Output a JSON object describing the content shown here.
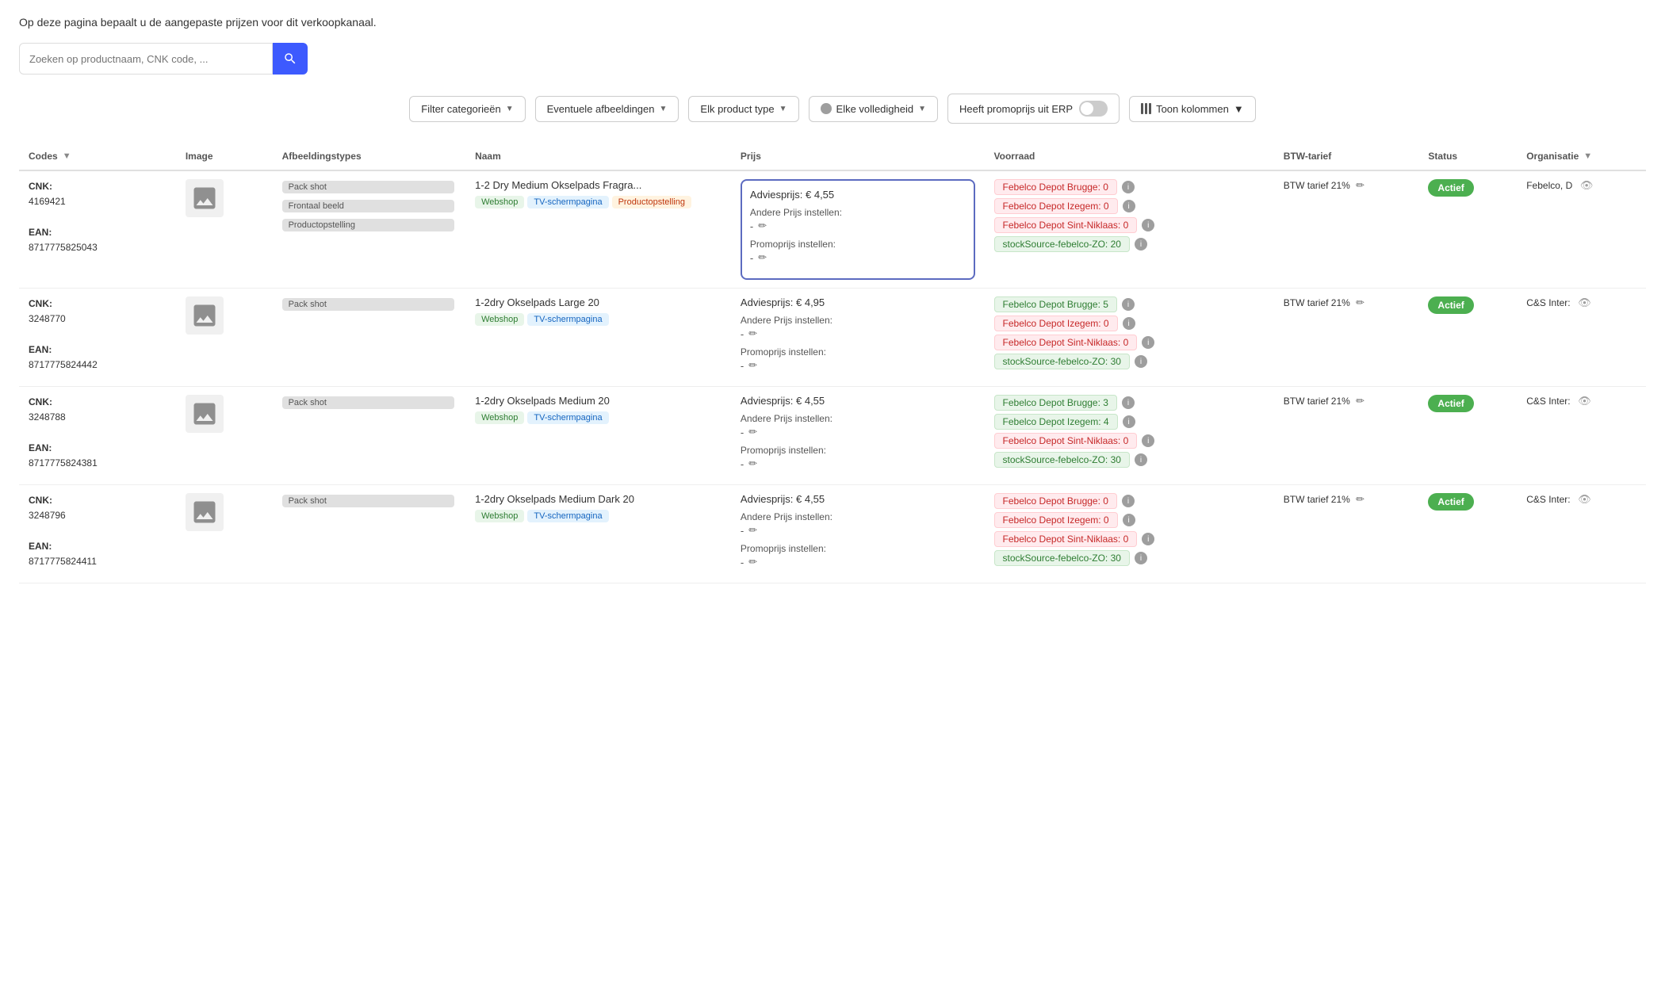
{
  "page": {
    "description": "Op deze pagina bepaalt u de aangepaste prijzen voor dit verkoopkanaal.",
    "search": {
      "placeholder": "Zoeken op productnaam, CNK code, ..."
    },
    "filters": {
      "categories_label": "Filter categorieën",
      "images_label": "Eventuele afbeeldingen",
      "product_type_label": "Elk product type",
      "completeness_label": "Elke volledigheid",
      "promo_label": "Heeft promoprijs uit ERP",
      "columns_label": "Toon kolommen"
    },
    "table": {
      "headers": [
        "Codes",
        "Image",
        "Afbeeldingstypes",
        "Naam",
        "Prijs",
        "Voorraad",
        "BTW-tarief",
        "Status",
        "Organisatie"
      ],
      "rows": [
        {
          "cnk": "CNK:",
          "cnk_value": "4169421",
          "ean": "EAN:",
          "ean_value": "8717775825043",
          "image_alt": "product image",
          "image_types": [
            "Pack shot",
            "Frontaal beeld"
          ],
          "image_type_extra": [
            "Productopstelling"
          ],
          "tags": [
            "Webshop",
            "TV-schermpagina",
            "Productopstelling"
          ],
          "naam": "1-2 Dry Medium Okselpads Fragra...",
          "adviesprijs": "Adviesprijs: € 4,55",
          "andere_prijs_label": "Andere Prijs instellen:",
          "andere_prijs_value": "-",
          "promo_label": "Promoprijs instellen:",
          "promo_value": "-",
          "highlighted": true,
          "stock": [
            {
              "label": "Febelco Depot Brugge: 0",
              "type": "red"
            },
            {
              "label": "Febelco Depot Izegem: 0",
              "type": "red"
            },
            {
              "label": "Febelco Depot Sint-Niklaas: 0",
              "type": "red"
            },
            {
              "label": "stockSource-febelco-ZO: 20",
              "type": "green"
            }
          ],
          "btw": "BTW tarief 21%",
          "status": "Actief",
          "org": "Febelco, D"
        },
        {
          "cnk": "CNK:",
          "cnk_value": "3248770",
          "ean": "EAN:",
          "ean_value": "8717775824442",
          "image_alt": "product image",
          "image_types": [
            "Pack shot"
          ],
          "tags": [
            "Webshop",
            "TV-schermpagina"
          ],
          "naam": "1-2dry Okselpads Large 20",
          "adviesprijs": "Adviesprijs: € 4,95",
          "andere_prijs_label": "Andere Prijs instellen:",
          "andere_prijs_value": "-",
          "promo_label": "Promoprijs instellen:",
          "promo_value": "-",
          "highlighted": false,
          "stock": [
            {
              "label": "Febelco Depot Brugge: 5",
              "type": "green"
            },
            {
              "label": "Febelco Depot Izegem: 0",
              "type": "red"
            },
            {
              "label": "Febelco Depot Sint-Niklaas: 0",
              "type": "red"
            },
            {
              "label": "stockSource-febelco-ZO: 30",
              "type": "green"
            }
          ],
          "btw": "BTW tarief 21%",
          "status": "Actief",
          "org": "C&S Inter:"
        },
        {
          "cnk": "CNK:",
          "cnk_value": "3248788",
          "ean": "EAN:",
          "ean_value": "8717775824381",
          "image_alt": "product image",
          "image_types": [
            "Pack shot"
          ],
          "tags": [
            "Webshop",
            "TV-schermpagina"
          ],
          "naam": "1-2dry Okselpads Medium 20",
          "adviesprijs": "Adviesprijs: € 4,55",
          "andere_prijs_label": "Andere Prijs instellen:",
          "andere_prijs_value": "-",
          "promo_label": "Promoprijs instellen:",
          "promo_value": "-",
          "highlighted": false,
          "stock": [
            {
              "label": "Febelco Depot Brugge: 3",
              "type": "green"
            },
            {
              "label": "Febelco Depot Izegem: 4",
              "type": "green"
            },
            {
              "label": "Febelco Depot Sint-Niklaas: 0",
              "type": "red"
            },
            {
              "label": "stockSource-febelco-ZO: 30",
              "type": "green"
            }
          ],
          "btw": "BTW tarief 21%",
          "status": "Actief",
          "org": "C&S Inter:"
        },
        {
          "cnk": "CNK:",
          "cnk_value": "3248796",
          "ean": "EAN:",
          "ean_value": "8717775824411",
          "image_alt": "product image",
          "image_types": [
            "Pack shot"
          ],
          "tags": [
            "Webshop",
            "TV-schermpagina"
          ],
          "naam": "1-2dry Okselpads Medium Dark 20",
          "adviesprijs": "Adviesprijs: € 4,55",
          "andere_prijs_label": "Andere Prijs instellen:",
          "andere_prijs_value": "-",
          "promo_label": "Promoprijs instellen:",
          "promo_value": "-",
          "highlighted": false,
          "stock": [
            {
              "label": "Febelco Depot Brugge: 0",
              "type": "red"
            },
            {
              "label": "Febelco Depot Izegem: 0",
              "type": "red"
            },
            {
              "label": "Febelco Depot Sint-Niklaas: 0",
              "type": "red"
            },
            {
              "label": "stockSource-febelco-ZO: 30",
              "type": "green"
            }
          ],
          "btw": "BTW tarief 21%",
          "status": "Actief",
          "org": "C&S Inter:"
        }
      ]
    }
  }
}
